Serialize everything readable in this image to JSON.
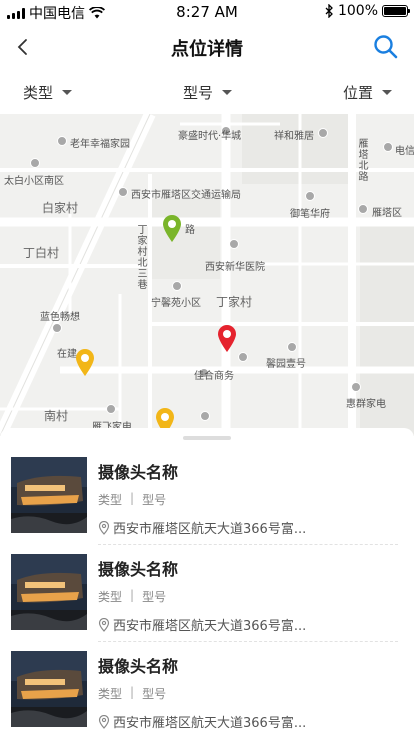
{
  "status_bar": {
    "carrier": "中国电信",
    "time": "8:27 AM",
    "battery": "100%",
    "battery_level": 1.0
  },
  "nav": {
    "title": "点位详情",
    "back_icon": "chevron-left-icon",
    "search_icon": "search-icon",
    "accent_color": "#1a7fe0"
  },
  "filters": [
    {
      "label": "类型"
    },
    {
      "label": "型号"
    },
    {
      "label": "位置"
    }
  ],
  "map": {
    "labels": [
      "老年幸福家园",
      "豪盛时代·华城",
      "祥和雅居",
      "电信",
      "太白小区南区",
      "西安市雁塔区交通运输局",
      "御笔华府",
      "雁塔区",
      "白家村",
      "路",
      "丁家村北三巷",
      "丁白村",
      "西安新华医院",
      "宁馨苑小区",
      "丁家村",
      "蓝色畅想",
      "在建",
      "馨园壹号",
      "佳合商务",
      "南村",
      "惠群家电",
      "雁飞家电",
      "雁塔北路"
    ],
    "pins": [
      {
        "color": "#7ab52a"
      },
      {
        "color": "#e5232e"
      },
      {
        "color": "#f2b618"
      },
      {
        "color": "#f2b618"
      }
    ]
  },
  "list": [
    {
      "title": "摄像头名称",
      "type": "类型",
      "model": "型号",
      "address": "西安市雁塔区航天大道366号富..."
    },
    {
      "title": "摄像头名称",
      "type": "类型",
      "model": "型号",
      "address": "西安市雁塔区航天大道366号富..."
    },
    {
      "title": "摄像头名称",
      "type": "类型",
      "model": "型号",
      "address": "西安市雁塔区航天大道366号富..."
    }
  ]
}
